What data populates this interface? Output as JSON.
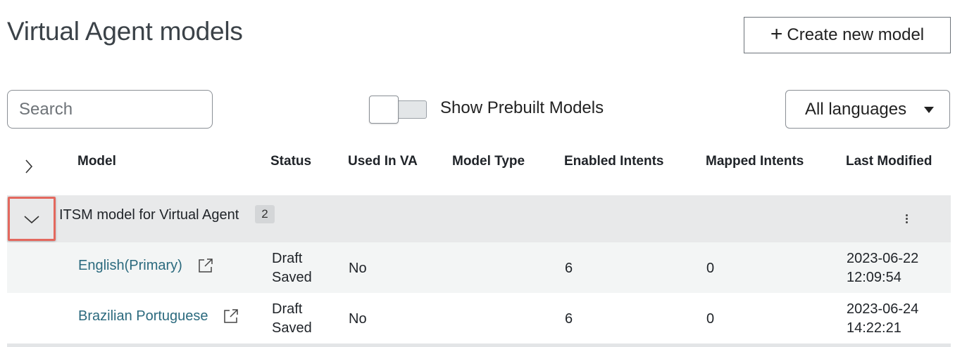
{
  "page": {
    "title": "Virtual Agent models",
    "create_button_label": "Create new model"
  },
  "filters": {
    "search_placeholder": "Search",
    "toggle_label": "Show Prebuilt Models",
    "toggle_on": false,
    "language_selected": "All languages"
  },
  "table": {
    "headers": {
      "model": "Model",
      "status": "Status",
      "used_in_va": "Used In VA",
      "model_type": "Model Type",
      "enabled_intents": "Enabled Intents",
      "mapped_intents": "Mapped Intents",
      "last_modified": "Last Modified"
    },
    "group": {
      "name": "ITSM model for Virtual Agent",
      "count": "2"
    },
    "rows": [
      {
        "model": "English(Primary)",
        "status_line1": "Draft",
        "status_line2": "Saved",
        "used_in_va": "No",
        "model_type": "",
        "enabled_intents": "6",
        "mapped_intents": "0",
        "modified_date": "2023-06-22",
        "modified_time": "12:09:54"
      },
      {
        "model": "Brazilian Portuguese",
        "status_line1": "Draft",
        "status_line2": "Saved",
        "used_in_va": "No",
        "model_type": "",
        "enabled_intents": "6",
        "mapped_intents": "0",
        "modified_date": "2023-06-24",
        "modified_time": "14:22:21"
      }
    ]
  },
  "icons": {
    "expand_all": "chevron-right-icon",
    "group_toggle": "chevron-down-icon",
    "row_menu": "kebab-menu-icon",
    "open_model": "external-link-icon",
    "language_caret": "caret-down-icon"
  },
  "colors": {
    "link": "#2b6a7e",
    "highlight_border": "#e3685e",
    "group_row_bg": "#e8e9ea"
  }
}
